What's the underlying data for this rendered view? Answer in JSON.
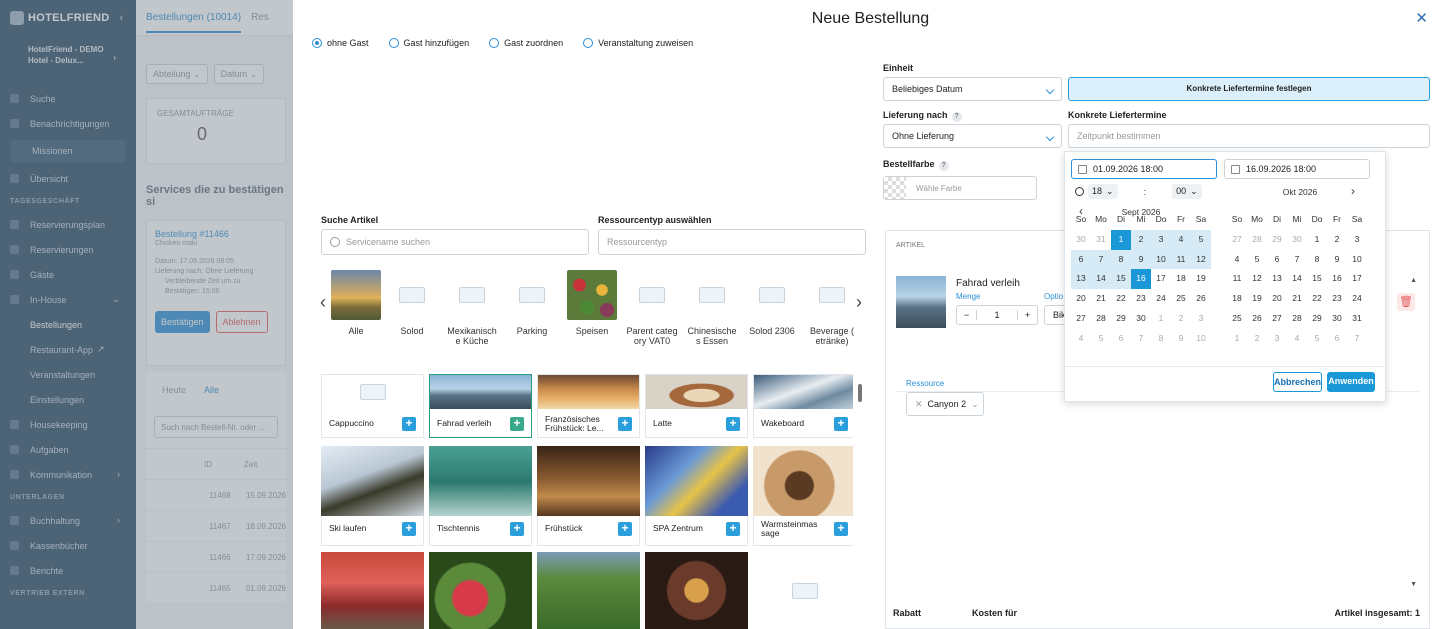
{
  "sidebar": {
    "logo": "HOTELFRIEND",
    "hotel": [
      "HotelFriend - DEMO",
      "Hotel - Delux..."
    ],
    "items": [
      {
        "label": "Suche"
      },
      {
        "label": "Benachrichtigungen"
      }
    ],
    "missions": "Missionen",
    "overview": "Übersicht",
    "section1": "TAGESGESCHÄFT",
    "section1_items": [
      "Reservierungsplan",
      "Reservierungen",
      "Gäste",
      "In-House"
    ],
    "inhouse_sub": [
      "Bestellungen",
      "Restaurant-App",
      "Veranstaltungen",
      "Einstellungen"
    ],
    "more": [
      "Housekeeping",
      "Aufgaben",
      "Kommunikation"
    ],
    "section2": "UNTERLAGEN",
    "section2_items": [
      "Buchhaltung",
      "Kassenbücher",
      "Berichte"
    ],
    "section3": "VERTRIEB EXTERN"
  },
  "background": {
    "tab1": "Bestellungen (10014)",
    "tab2": "Res",
    "filter1": "Abteilung",
    "filter2": "Datum",
    "card_label": "GESAMTAUFTRÄGE",
    "card_value": "0",
    "heading": "Services die zu bestätigen si",
    "order_title": "Bestellung #11466",
    "order_sub": "Chicken maki",
    "order_lines": [
      "Datum: 17.09.2026 09:05",
      "Lieferung nach: Ohne Lieferung",
      "Verbleibende Zeit um zu",
      "Bestätigen: 15:06"
    ],
    "confirm": "Bestätigen",
    "reject": "Ablehnen",
    "tab_today": "Heute",
    "tab_all": "Alle",
    "search_placeholder": "Such nach Bestell-Nr. oder ...",
    "col_id": "ID",
    "col_time": "Zeit",
    "rows": [
      {
        "id": "11468",
        "date": "15.09.2026"
      },
      {
        "id": "11467",
        "date": "18.09.2026"
      },
      {
        "id": "11466",
        "date": "17.09.2026"
      },
      {
        "id": "11465",
        "date": "01.09.2026"
      }
    ]
  },
  "modal": {
    "title": "Neue Bestellung",
    "close": "✕",
    "radios": [
      {
        "label": "ohne Gast",
        "checked": true
      },
      {
        "label": "Gast hinzufügen",
        "checked": false
      },
      {
        "label": "Gast zuordnen",
        "checked": false
      },
      {
        "label": "Veranstaltung zuweisen",
        "checked": false
      }
    ],
    "search_label": "Suche Artikel",
    "search_placeholder": "Servicename suchen",
    "resource_label": "Ressourcentyp auswählen",
    "resource_placeholder": "Ressourcentyp",
    "categories": [
      "Alle",
      "Solod",
      "Mexikanische Küche",
      "Parking",
      "Speisen",
      "Parent category VAT0",
      "Chinesisches Essen",
      "Solod 2306",
      "Beverage (getränke)"
    ],
    "categories_display": [
      [
        "Alle"
      ],
      [
        "Solod"
      ],
      [
        "Mexikanisch",
        "e Küche"
      ],
      [
        "Parking"
      ],
      [
        "Speisen"
      ],
      [
        "Parent categ",
        "ory VAT0"
      ],
      [
        "Chinesische",
        "s Essen"
      ],
      [
        "Solod 2306"
      ],
      [
        "Beverage (",
        "etränke)"
      ]
    ],
    "products": [
      {
        "name": "Cappuccino"
      },
      {
        "name": "Fahrad verleih",
        "selected": true
      },
      {
        "name": "Französisches Frühstück: Le..."
      },
      {
        "name": "Latte"
      },
      {
        "name": "Wakeboard"
      },
      {
        "name": "Ski laufen"
      },
      {
        "name": "Tischtennis"
      },
      {
        "name": "Frühstück"
      },
      {
        "name": "SPA Zentrum"
      },
      {
        "name": "Warmsteinmassage"
      }
    ],
    "products_display": [
      "Cappuccino",
      "Fahrad verleih",
      "Französisches Frühstück: Le...",
      "Latte",
      "Wakeboard",
      "Ski laufen",
      "Tischtennis",
      "Frühstück",
      "SPA Zentrum",
      "Warmsteinmas sage"
    ]
  },
  "right": {
    "unit_label": "Einheit",
    "unit_value": "Beliebiges Datum",
    "fixed_dates_button": "Konkrete Liefertermine festlegen",
    "delivery_label": "Lieferung nach",
    "delivery_value": "Ohne Lieferung",
    "dates_label": "Konkrete Liefertermine",
    "dates_placeholder": "Zeitpunkt bestimmen",
    "color_label": "Bestellfarbe",
    "color_placeholder": "Wähle Farbe",
    "article_header": "ARTIKEL",
    "article_name": "Fahrad verleih",
    "qty_label": "Menge",
    "qty_value": "1",
    "option_label": "Optio",
    "option_value": "Bik",
    "resource_label": "Ressource",
    "resource_value": "Canyon 2",
    "discount": "Rabatt",
    "costs_for": "Kosten für",
    "total": "Artikel insgesamt: 1"
  },
  "calendar": {
    "start": "01.09.2026 18:00",
    "end": "16.09.2026 18:00",
    "hour": "18",
    "minute": "00",
    "weekdays": [
      "So",
      "Mo",
      "Di",
      "Mi",
      "Do",
      "Fr",
      "Sa"
    ],
    "left_month": "Sept 2026",
    "right_month": "Okt 2026",
    "left_days": [
      [
        "30",
        "31",
        "1",
        "2",
        "3",
        "4",
        "5"
      ],
      [
        "6",
        "7",
        "8",
        "9",
        "10",
        "11",
        "12"
      ],
      [
        "13",
        "14",
        "15",
        "16",
        "17",
        "18",
        "19"
      ],
      [
        "20",
        "21",
        "22",
        "23",
        "24",
        "25",
        "26"
      ],
      [
        "27",
        "28",
        "29",
        "30",
        "1",
        "2",
        "3"
      ],
      [
        "4",
        "5",
        "6",
        "7",
        "8",
        "9",
        "10"
      ]
    ],
    "right_days": [
      [
        "27",
        "28",
        "29",
        "30",
        "1",
        "2",
        "3"
      ],
      [
        "4",
        "5",
        "6",
        "7",
        "8",
        "9",
        "10"
      ],
      [
        "11",
        "12",
        "13",
        "14",
        "15",
        "16",
        "17"
      ],
      [
        "18",
        "19",
        "20",
        "21",
        "22",
        "23",
        "24"
      ],
      [
        "25",
        "26",
        "27",
        "28",
        "29",
        "30",
        "31"
      ],
      [
        "1",
        "2",
        "3",
        "4",
        "5",
        "6",
        "7"
      ]
    ],
    "cancel": "Abbrechen",
    "apply": "Anwenden",
    "accent": "#1a97d7",
    "range_color": "#d6ebf6"
  }
}
